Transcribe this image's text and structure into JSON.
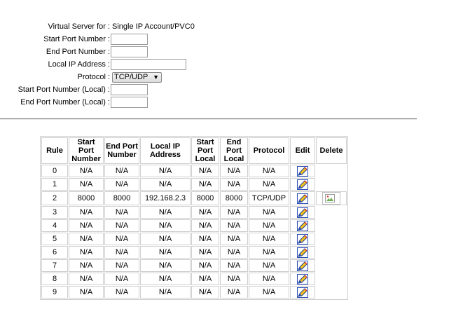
{
  "form": {
    "virtual_server_label": "Virtual Server for :",
    "virtual_server_value": "Single IP Account/PVC0",
    "start_port_label": "Start Port Number :",
    "start_port_value": "",
    "end_port_label": "End Port Number :",
    "end_port_value": "",
    "local_ip_label": "Local IP Address :",
    "local_ip_value": "",
    "protocol_label": "Protocol :",
    "protocol_selected": "TCP/UDP",
    "start_port_local_label": "Start Port Number (Local) :",
    "start_port_local_value": "",
    "end_port_local_label": "End Port Number (Local) :",
    "end_port_local_value": ""
  },
  "table": {
    "headers": {
      "rule": "Rule",
      "start_port_1": "Start",
      "start_port_2": "Port",
      "start_port_3": "Number",
      "end_port_1": "End Port",
      "end_port_2": "Number",
      "local_ip_1": "Local IP",
      "local_ip_2": "Address",
      "start_local_1": "Start",
      "start_local_2": "Port",
      "start_local_3": "Local",
      "end_local_1": "End",
      "end_local_2": "Port",
      "end_local_3": "Local",
      "protocol": "Protocol",
      "edit": "Edit",
      "delete": "Delete"
    },
    "rows": [
      {
        "rule": "0",
        "start_port": "N/A",
        "end_port": "N/A",
        "local_ip": "N/A",
        "start_local": "N/A",
        "end_local": "N/A",
        "protocol": "N/A"
      },
      {
        "rule": "1",
        "start_port": "N/A",
        "end_port": "N/A",
        "local_ip": "N/A",
        "start_local": "N/A",
        "end_local": "N/A",
        "protocol": "N/A"
      },
      {
        "rule": "2",
        "start_port": "8000",
        "end_port": "8000",
        "local_ip": "192.168.2.3",
        "start_local": "8000",
        "end_local": "8000",
        "protocol": "TCP/UDP"
      },
      {
        "rule": "3",
        "start_port": "N/A",
        "end_port": "N/A",
        "local_ip": "N/A",
        "start_local": "N/A",
        "end_local": "N/A",
        "protocol": "N/A"
      },
      {
        "rule": "4",
        "start_port": "N/A",
        "end_port": "N/A",
        "local_ip": "N/A",
        "start_local": "N/A",
        "end_local": "N/A",
        "protocol": "N/A"
      },
      {
        "rule": "5",
        "start_port": "N/A",
        "end_port": "N/A",
        "local_ip": "N/A",
        "start_local": "N/A",
        "end_local": "N/A",
        "protocol": "N/A"
      },
      {
        "rule": "6",
        "start_port": "N/A",
        "end_port": "N/A",
        "local_ip": "N/A",
        "start_local": "N/A",
        "end_local": "N/A",
        "protocol": "N/A"
      },
      {
        "rule": "7",
        "start_port": "N/A",
        "end_port": "N/A",
        "local_ip": "N/A",
        "start_local": "N/A",
        "end_local": "N/A",
        "protocol": "N/A"
      },
      {
        "rule": "8",
        "start_port": "N/A",
        "end_port": "N/A",
        "local_ip": "N/A",
        "start_local": "N/A",
        "end_local": "N/A",
        "protocol": "N/A"
      },
      {
        "rule": "9",
        "start_port": "N/A",
        "end_port": "N/A",
        "local_ip": "N/A",
        "start_local": "N/A",
        "end_local": "N/A",
        "protocol": "N/A"
      }
    ]
  },
  "icons": {
    "edit": "edit-pencil-icon",
    "delete": "broken-image-icon"
  },
  "colors": {
    "border": "#cfcfcf",
    "divider": "#7c7c7c",
    "edit_icon_blue": "#2a4fb5",
    "edit_icon_yellow": "#f4c21b"
  }
}
